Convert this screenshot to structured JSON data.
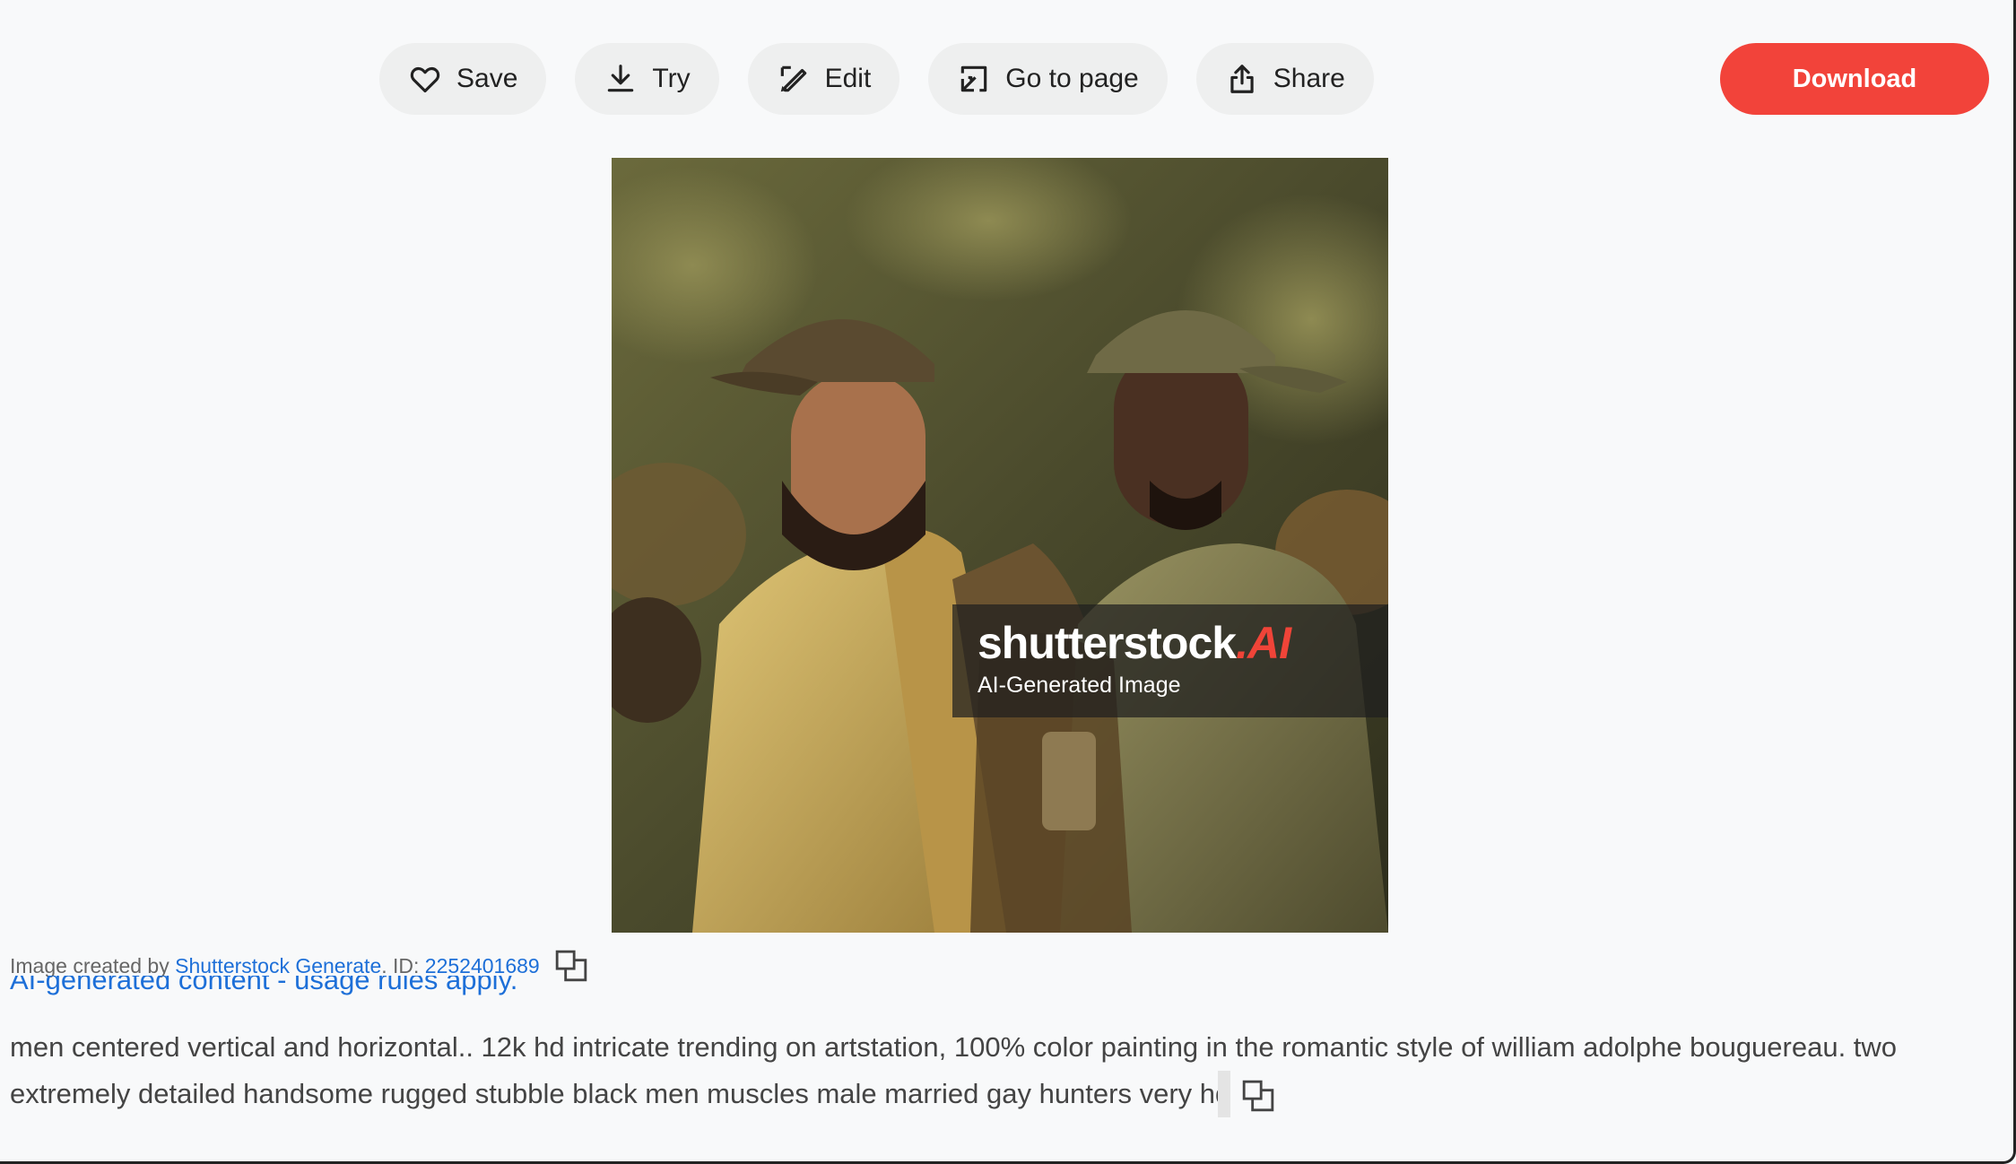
{
  "toolbar": {
    "save_label": "Save",
    "try_label": "Try",
    "edit_label": "Edit",
    "go_to_page_label": "Go to page",
    "share_label": "Share",
    "download_label": "Download"
  },
  "image": {
    "watermark_brand": "shutterstock",
    "watermark_brand_suffix": ".AI",
    "watermark_caption": "AI-Generated Image"
  },
  "credit": {
    "prefix": "Image created by",
    "generator_link": "Shutterstock Generate",
    "id_prefix": ". ID:",
    "id_value": "2252401689"
  },
  "usage_link": "AI-generated content - usage rules apply.",
  "description": "men centered vertical and horizontal.. 12k hd intricate trending on artstation, 100% color painting in the romantic style of william adolphe bouguereau. two extremely detailed handsome rugged stubble black men muscles male married gay hunters very hd",
  "colors": {
    "download_bg": "#f2433a",
    "link": "#1d6fd8",
    "button_bg": "#eeefef"
  }
}
